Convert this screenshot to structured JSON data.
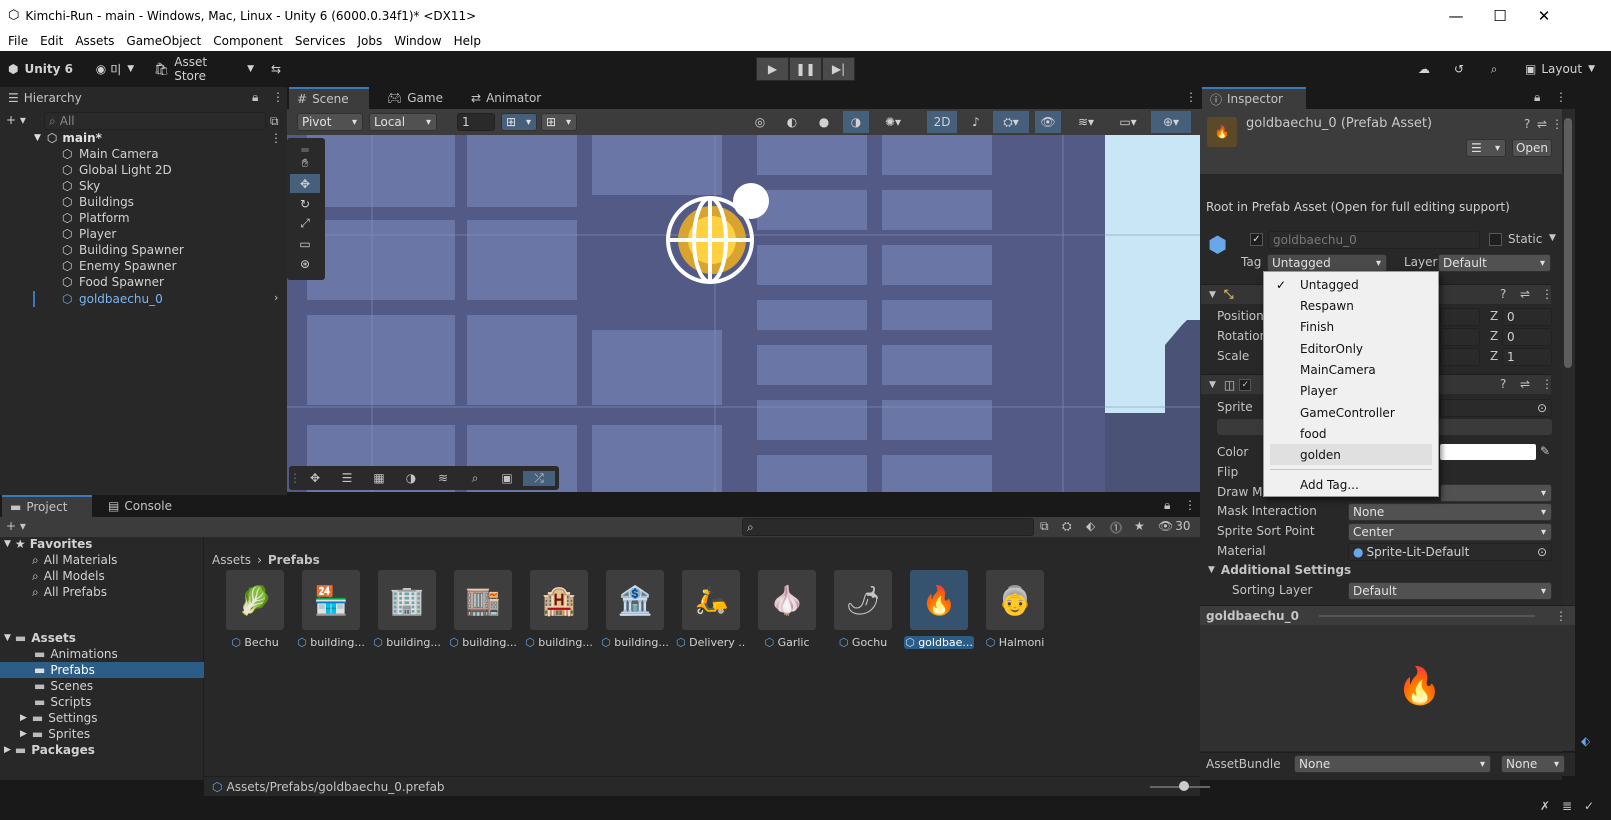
{
  "window": {
    "title": "Kimchi-Run - main - Windows, Mac, Linux - Unity 6 (6000.0.34f1)* <DX11>",
    "minimize": "—",
    "maximize": "☐",
    "close": "✕"
  },
  "menu": [
    "File",
    "Edit",
    "Assets",
    "GameObject",
    "Component",
    "Services",
    "Jobs",
    "Window",
    "Help"
  ],
  "toolbar": {
    "unity_label": "Unity 6",
    "account": "미",
    "asset_store": "Asset Store",
    "layout": "Layout"
  },
  "hierarchy": {
    "tab": "Hierarchy",
    "search_placeholder": "All",
    "scene": "main*",
    "items": [
      "Main Camera",
      "Global Light 2D",
      "Sky",
      "Buildings",
      "Platform",
      "Player",
      "Building Spawner",
      "Enemy Spawner",
      "Food Spawner",
      "goldbaechu_0"
    ]
  },
  "scene_view": {
    "tabs": [
      "Scene",
      "Game",
      "Animator"
    ],
    "pivot": "Pivot",
    "local": "Local",
    "grid_value": "1",
    "mode_2d": "2D"
  },
  "inspector": {
    "tab": "Inspector",
    "header_title": "goldbaechu_0 (Prefab Asset)",
    "open_button": "Open",
    "root_note": "Root in Prefab Asset (Open for full editing support)",
    "object_name": "goldbaechu_0",
    "static_label": "Static",
    "tag_label": "Tag",
    "tag_value": "Untagged",
    "layer_label": "Layer",
    "layer_value": "Default",
    "position_label": "Position",
    "rotation_label": "Rotation",
    "scale_label": "Scale",
    "axis_z": "Z",
    "pos_z": "0",
    "rot_z": "0",
    "scale_z": "1",
    "sprite_label": "Sprite",
    "color_label": "Color",
    "flip_label": "Flip",
    "draw_mode_label": "Draw Mo",
    "mask_interaction_label": "Mask Interaction",
    "mask_interaction_value": "None",
    "sprite_sort_point_label": "Sprite Sort Point",
    "sprite_sort_point_value": "Center",
    "material_label": "Material",
    "material_value": "Sprite-Lit-Default",
    "additional_settings": "Additional Settings",
    "sorting_layer_label": "Sorting Layer",
    "sorting_layer_value": "Default",
    "preview_title": "goldbaechu_0",
    "assetbundle_label": "AssetBundle",
    "assetbundle_value": "None",
    "assetbundle_variant": "None"
  },
  "tag_menu": {
    "items": [
      "Untagged",
      "Respawn",
      "Finish",
      "EditorOnly",
      "MainCamera",
      "Player",
      "GameController",
      "food",
      "golden"
    ],
    "add_tag": "Add Tag...",
    "checked": "✓"
  },
  "project": {
    "tabs": [
      "Project",
      "Console"
    ],
    "hidden_count": "30",
    "favorites": "Favorites",
    "favorite_items": [
      "All Materials",
      "All Models",
      "All Prefabs"
    ],
    "assets_root": "Assets",
    "asset_folders": [
      "Animations",
      "Prefabs",
      "Scenes",
      "Scripts",
      "Settings",
      "Sprites"
    ],
    "packages": "Packages",
    "breadcrumb_root": "Assets",
    "breadcrumb_current": "Prefabs",
    "assets": [
      {
        "label": "Bechu",
        "icon": "🥬"
      },
      {
        "label": "building...",
        "icon": "🏪"
      },
      {
        "label": "building...",
        "icon": "🏢"
      },
      {
        "label": "building...",
        "icon": "🏬"
      },
      {
        "label": "building...",
        "icon": "🏨"
      },
      {
        "label": "building...",
        "icon": "🏦"
      },
      {
        "label": "Delivery ...",
        "icon": "🛵"
      },
      {
        "label": "Garlic",
        "icon": "🧄"
      },
      {
        "label": "Gochu",
        "icon": "🌶"
      },
      {
        "label": "goldbae...",
        "icon": "🔥"
      },
      {
        "label": "Halmoni",
        "icon": "👵"
      }
    ],
    "status_path": "Assets/Prefabs/goldbaechu_0.prefab"
  },
  "colors": {
    "selection_blue": "#2c5d87",
    "accent_blue": "#3a79bb",
    "scene_bg": "#525a85"
  }
}
